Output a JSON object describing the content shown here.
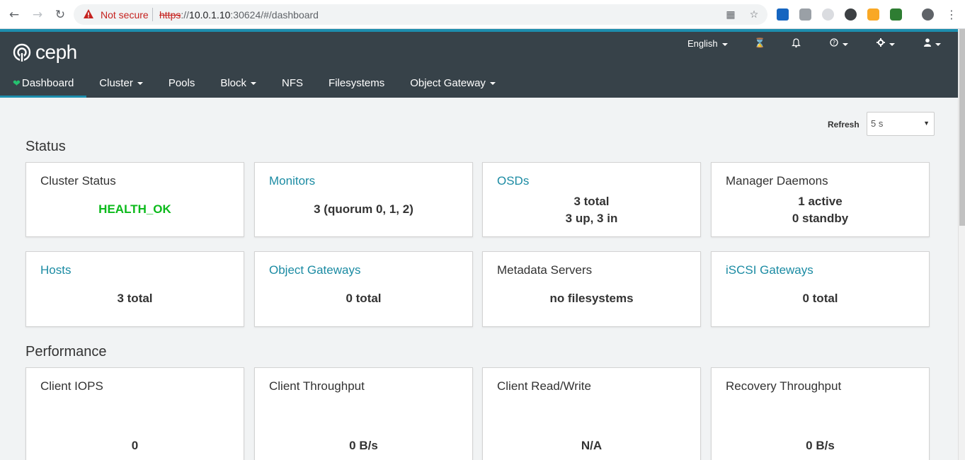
{
  "browser": {
    "security_label": "Not secure",
    "url_scheme": "https",
    "url_sep": "://",
    "url_host": "10.0.1.10",
    "url_rest": ":30624/#/dashboard"
  },
  "app": {
    "logo_text": "ceph",
    "language": "English"
  },
  "menu": {
    "items": [
      {
        "label": "Dashboard",
        "active": true
      },
      {
        "label": "Cluster",
        "dropdown": true
      },
      {
        "label": "Pools"
      },
      {
        "label": "Block",
        "dropdown": true
      },
      {
        "label": "NFS"
      },
      {
        "label": "Filesystems"
      },
      {
        "label": "Object Gateway",
        "dropdown": true
      }
    ]
  },
  "refresh": {
    "label": "Refresh",
    "value": "5 s"
  },
  "status": {
    "title": "Status",
    "cards": [
      {
        "title": "Cluster Status",
        "lines": [
          "HEALTH_OK"
        ]
      },
      {
        "title": "Monitors",
        "lines": [
          "3 (quorum 0, 1, 2)"
        ]
      },
      {
        "title": "OSDs",
        "lines": [
          "3 total",
          "3 up, 3 in"
        ]
      },
      {
        "title": "Manager Daemons",
        "lines": [
          "1 active",
          "0 standby"
        ]
      },
      {
        "title": "Hosts",
        "lines": [
          "3 total"
        ]
      },
      {
        "title": "Object Gateways",
        "lines": [
          "0 total"
        ]
      },
      {
        "title": "Metadata Servers",
        "lines": [
          "no filesystems"
        ]
      },
      {
        "title": "iSCSI Gateways",
        "lines": [
          "0 total"
        ]
      }
    ]
  },
  "performance": {
    "title": "Performance",
    "cards": [
      {
        "title": "Client IOPS",
        "value": "0"
      },
      {
        "title": "Client Throughput",
        "value": "0 B/s"
      },
      {
        "title": "Client Read/Write",
        "value": "N/A"
      },
      {
        "title": "Recovery Throughput",
        "value": "0 B/s"
      }
    ]
  },
  "colors": {
    "header_bg": "#374249",
    "accent": "#1d8eae",
    "health_ok": "#0bba1b",
    "link": "#1b8ba3"
  }
}
